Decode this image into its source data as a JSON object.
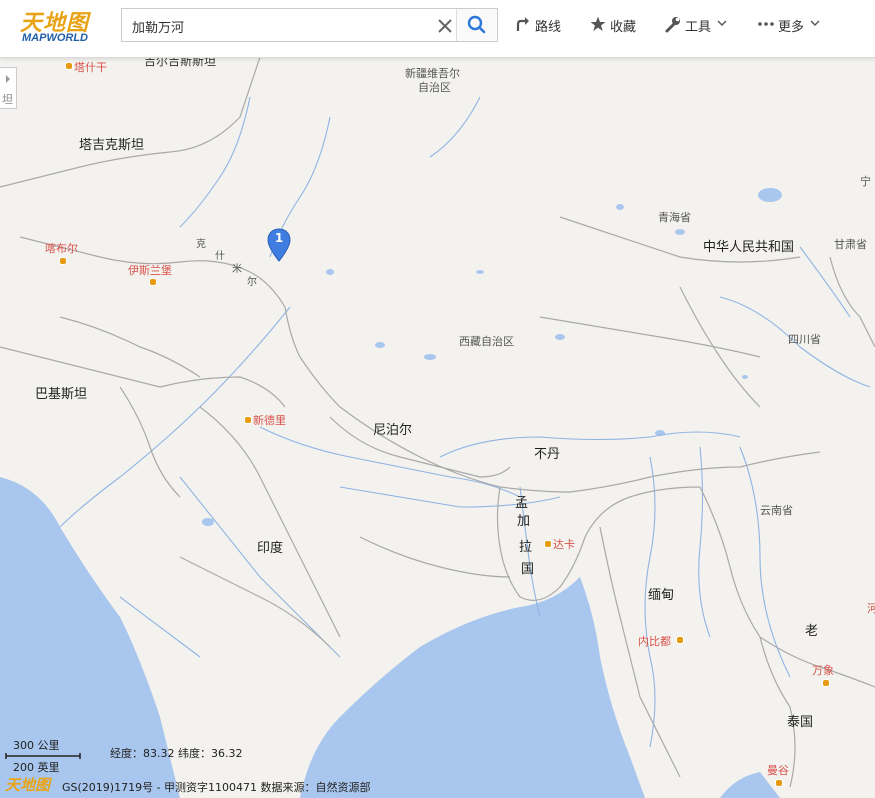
{
  "header": {
    "logo_cn": "天地图",
    "logo_en": "MAPWORLD",
    "search_value": "加勒万河",
    "nav": {
      "route": "路线",
      "favorites": "收藏",
      "tools": "工具",
      "more": "更多"
    }
  },
  "map": {
    "side_tab": "坦",
    "marker_number": "1",
    "labels": {
      "kyrgyzstan": "吉尔吉斯斯坦",
      "kashgar": "塔什干",
      "xinjiang_1": "新疆维吾尔",
      "xinjiang_2": "自治区",
      "tajikistan": "塔吉克斯坦",
      "qinghai": "青海省",
      "china": "中华人民共和国",
      "gansu": "甘肃省",
      "ning": "宁",
      "kabul": "喀布尔",
      "islamabad": "伊斯兰堡",
      "kashmir_1": "克",
      "kashmir_2": "什",
      "kashmir_3": "米",
      "kashmir_4": "尔",
      "tibet": "西藏自治区",
      "sichuan": "四川省",
      "pakistan": "巴基斯坦",
      "new_delhi": "新德里",
      "nepal": "尼泊尔",
      "bhutan": "不丹",
      "bangladesh_1": "孟",
      "bangladesh_2": "加",
      "bangladesh_3": "拉",
      "bangladesh_4": "国",
      "dhaka": "达卡",
      "yunnan": "云南省",
      "india": "印度",
      "myanmar": "缅甸",
      "naypyidaw": "内比都",
      "laos": "老",
      "vientiane": "万象",
      "thailand": "泰国",
      "bangkok": "曼谷",
      "hanoi_partial": "河"
    }
  },
  "status": {
    "scale_km": "300 公里",
    "scale_mi": "200 英里",
    "coords": "经度：83.32  纬度：36.32",
    "footer_logo": "天地图",
    "copyright": "GS(2019)1719号 - 甲测资字1100471 数据来源：自然资源部"
  },
  "colors": {
    "land": "#f3f2ee",
    "water": "#a9c6ee",
    "river": "#8fb4e4",
    "border": "#a9a9a9",
    "marker": "#3f7de0",
    "city_label": "#d8524a",
    "city_dot": "#e79a12",
    "logo_gold": "#e8a416",
    "logo_blue": "#1f5fa8"
  },
  "icons": [
    "search-icon",
    "close-icon",
    "route-icon",
    "star-icon",
    "wrench-icon",
    "more-dots-icon",
    "chevron-down-icon",
    "map-pin-icon"
  ]
}
